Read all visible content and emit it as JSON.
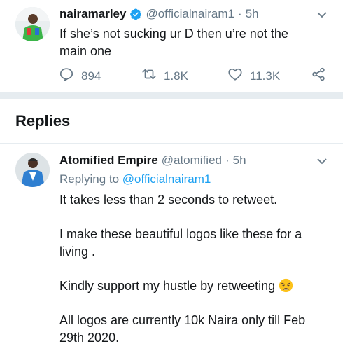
{
  "tweet": {
    "display_name": "nairamarley",
    "handle": "@officialnairam1",
    "separator": "·",
    "time": "5h",
    "text_line1": "If she’s not sucking ur D then u’re not the",
    "text_line2": "main one",
    "replies_count": "894",
    "retweets_count": "1.8K",
    "likes_count": "11.3K"
  },
  "section": {
    "title": "Replies"
  },
  "reply": {
    "display_name": "Atomified Empire",
    "handle": "@atomified",
    "separator": "·",
    "time": "5h",
    "replying_prefix": "Replying to",
    "replying_handle": "@officialnairam1",
    "p1": "It takes less than 2 seconds to retweet.",
    "p2_line1": "I make these beautiful logos like these for a",
    "p2_line2": "living .",
    "p3": "Kindly support my hustle by retweeting",
    "p4_line1": "All logos are currently 10k Naira only till Feb",
    "p4_line2": "29th 2020."
  },
  "colors": {
    "accent": "#1da1f2",
    "muted": "#657786",
    "text": "#14171a",
    "separator": "#e6ecf0"
  },
  "icons": [
    "verified-badge-icon",
    "chevron-down-icon",
    "reply-icon",
    "retweet-icon",
    "like-icon",
    "share-icon",
    "weary-face-emoji"
  ]
}
